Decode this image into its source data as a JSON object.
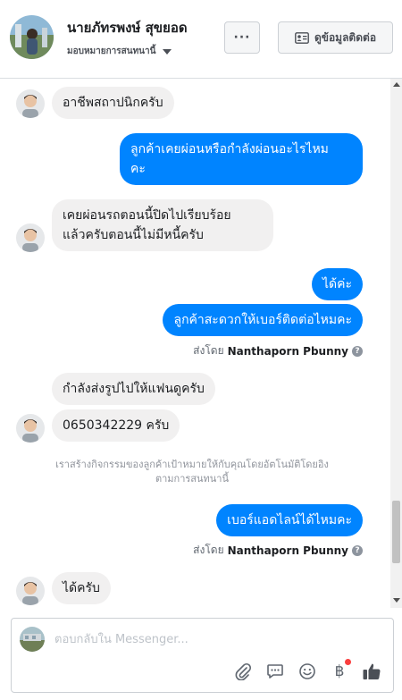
{
  "header": {
    "name": "นายภัทรพงษ์ สุขยอด",
    "assigned": "มอบหมายการสนทนานี้",
    "more_label": "···",
    "contact_label": "ดูข้อมูลติดต่อ"
  },
  "messages": {
    "m1": "อาชีพสถาปนิกครับ",
    "m2_l1": "ลูกค้าเคยผ่อนหรือกำลังผ่อนอะไรไหม",
    "m2_l2": "คะ",
    "m3_l1": "เคยผ่อนรถตอนนี้ปิดไปเรียบร้อย",
    "m3_l2": "แล้วครับตอนนี้ไม่มีหนี้ครับ",
    "m4": "ได้ค่ะ",
    "m5": "ลูกค้าสะดวกให้เบอร์ติดต่อไหมคะ",
    "m6": "กำลังส่งรูปไปให้แฟนดูครับ",
    "m7": "0650342229 ครับ",
    "m8": "เบอร์แอดไลน์ได้ไหมคะ",
    "m9": "ได้ครับ"
  },
  "sent_by": {
    "prefix": "ส่งโดย",
    "agent": "Nanthaporn Pbunny",
    "info_glyph": "?"
  },
  "system_note": {
    "l1": "เราสร้างกิจกรรมของลูกค้าเป้าหมายให้กับคุณโดยอัตโนมัติโดยอิง",
    "l2": "ตามการสนทนานี้"
  },
  "composer": {
    "placeholder": "ตอบกลับใน Messenger...",
    "baht_glyph": "฿"
  },
  "colors": {
    "outgoing": "#0084ff",
    "incoming": "#f1f0f0",
    "notification": "#fa3e3e"
  },
  "icons": [
    "ellipsis-icon",
    "contact-card-icon",
    "attachment-icon",
    "saved-reply-icon",
    "emoji-icon",
    "payment-icon",
    "like-icon"
  ]
}
